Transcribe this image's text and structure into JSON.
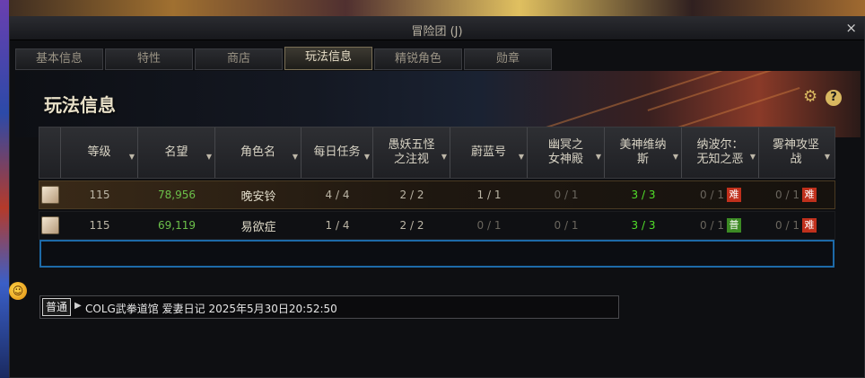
{
  "window": {
    "title": "冒险团 (J)",
    "close": "×"
  },
  "tabs": [
    "基本信息",
    "特性",
    "商店",
    "玩法信息",
    "精锐角色",
    "勋章"
  ],
  "active_tab": "玩法信息",
  "section_title": "玩法信息",
  "icons": {
    "settings": "gear-icon",
    "help": "?"
  },
  "table": {
    "headers": [
      "等级",
      "名望",
      "角色名",
      "每日任务",
      "愚妖五怪\n之注视",
      "蔚蓝号",
      "幽冥之\n女神殿",
      "美神维纳\n斯",
      "纳波尔：\n无知之恶",
      "雾神攻坚\n战"
    ],
    "rows": [
      {
        "level": "115",
        "fame": "78,956",
        "name": "晚安铃",
        "daily": "4 / 4",
        "c5": "2 / 2",
        "c6": "1 / 1",
        "c7": "0 / 1",
        "c8": "3 / 3",
        "c9": "0 / 1",
        "c9_badge": "难",
        "c10": "0 / 1",
        "c10_badge": "难"
      },
      {
        "level": "115",
        "fame": "69,119",
        "name": "易欲症",
        "daily": "1 / 4",
        "c5": "2 / 2",
        "c6": "0 / 1",
        "c7": "0 / 1",
        "c8": "3 / 3",
        "c9": "0 / 1",
        "c9_badge": "普",
        "c10": "0 / 1",
        "c10_badge": "难"
      }
    ]
  },
  "chat": {
    "channel": "普通",
    "message": "COLG武拳道馆 爱妻日记 2025年5月30日20:52:50"
  },
  "colors": {
    "accent": "#d8b860",
    "green": "#52e02a",
    "fame": "#6cc04a",
    "hard": "#c0301c",
    "normal_badge": "#3c8a24",
    "selection": "#1d6aa8"
  }
}
